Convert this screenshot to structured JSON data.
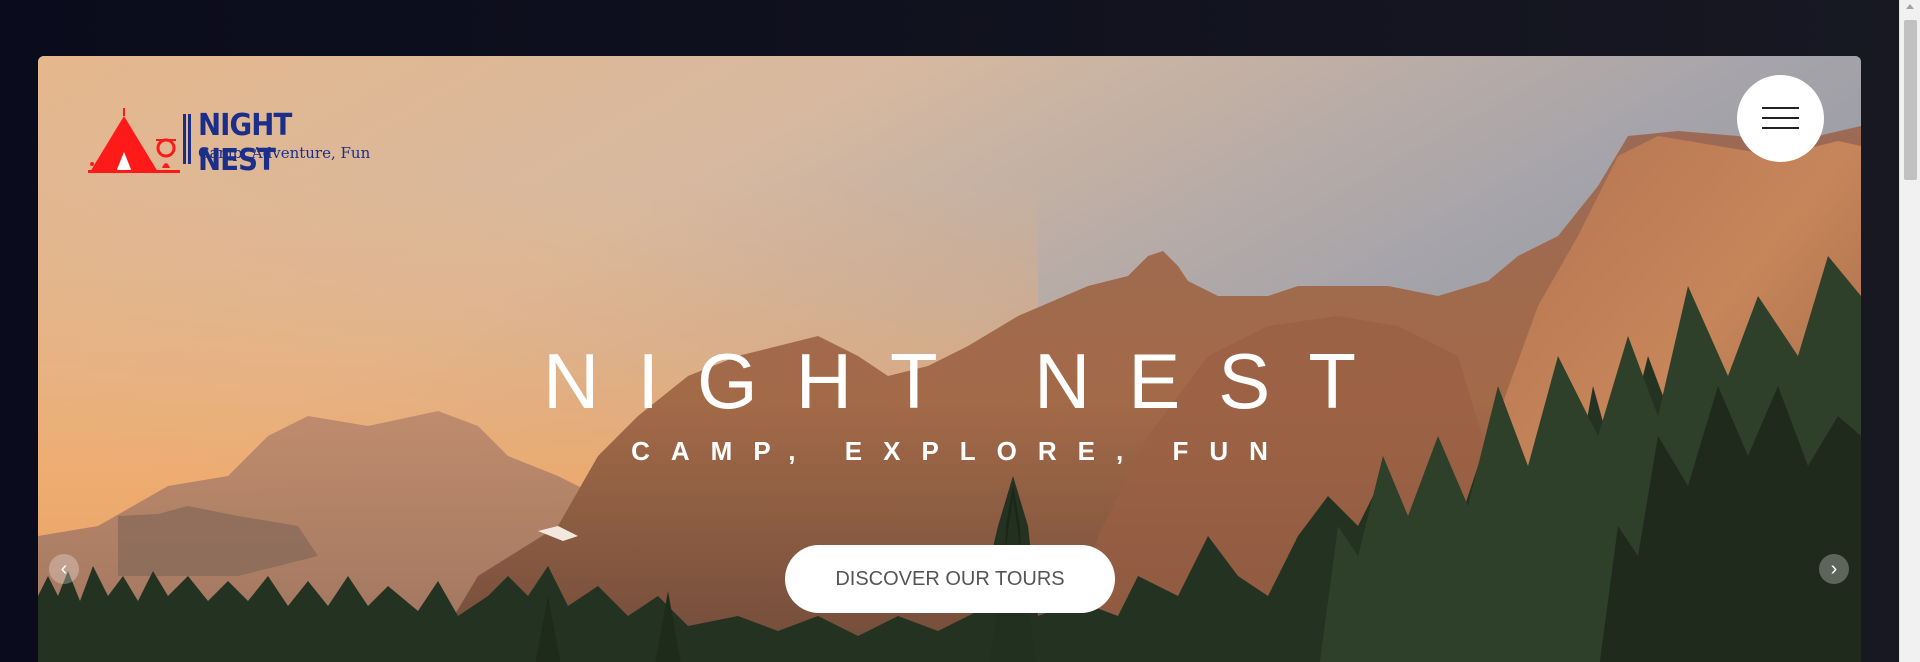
{
  "brand": {
    "name": "NIGHT NEST",
    "tagline": "Camp, Adventure, Fun",
    "logo_icon": "tent-campfire-icon",
    "colors": {
      "primary": "#1b2f8a",
      "accent": "#ff1a1a"
    }
  },
  "nav": {
    "menu_icon": "hamburger-menu-icon"
  },
  "hero": {
    "title": "NIGHT NEST",
    "subtitle": "CAMP, EXPLORE, FUN",
    "cta_label": "DISCOVER OUR TOURS",
    "prev_icon": "chevron-left-icon",
    "next_icon": "chevron-right-icon",
    "prev_glyph": "‹",
    "next_glyph": "›"
  }
}
